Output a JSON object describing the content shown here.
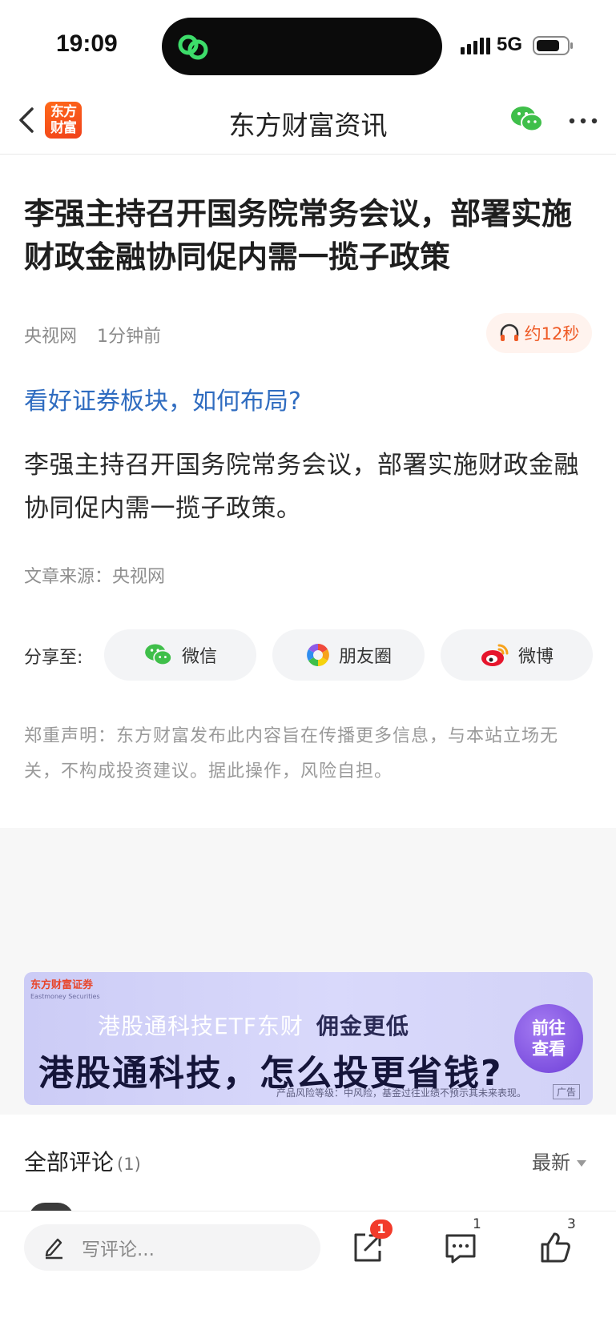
{
  "status_bar": {
    "time": "19:09",
    "network": "5G",
    "icons": [
      "link-icon",
      "signal-icon",
      "battery-icon"
    ]
  },
  "nav": {
    "logo_line1": "东方",
    "logo_line2": "财富",
    "title": "东方财富资讯",
    "icons": [
      "back-icon",
      "wechat-icon",
      "more-icon"
    ]
  },
  "article": {
    "headline": "李强主持召开国务院常务会议，部署实施财政金融协同促内需一揽子政策",
    "source": "央视网",
    "time_ago": "1分钟前",
    "audio_label": "约12秒",
    "promo_link": "看好证券板块，如何布局?",
    "body": "李强主持召开国务院常务会议，部署实施财政金融协同促内需一揽子政策。",
    "source_line": "文章来源：央视网"
  },
  "share": {
    "label": "分享至:",
    "buttons": [
      {
        "label": "微信",
        "icon": "wechat-icon"
      },
      {
        "label": "朋友圈",
        "icon": "moments-icon"
      },
      {
        "label": "微博",
        "icon": "weibo-icon"
      }
    ]
  },
  "disclaimer": "郑重声明：东方财富发布此内容旨在传播更多信息，与本站立场无关，不构成投资建议。据此操作，风险自担。",
  "ad": {
    "brand": "东方财富证券",
    "brand_en": "Eastmoney Securities",
    "line1": "港股通科技ETF东财",
    "line1_bold": "佣金更低",
    "line2": "港股通科技，怎么投更省钱?",
    "cta_line1": "前往",
    "cta_line2": "查看",
    "note": "产品风险等级：中风险，基金过往业绩不预示其未来表现。",
    "tag": "广告"
  },
  "comments": {
    "title": "全部评论",
    "count": "(1)",
    "sort_label": "最新"
  },
  "bottom_bar": {
    "placeholder": "写评论...",
    "share_badge": "1",
    "comment_count": "1",
    "like_count": "3"
  },
  "colors": {
    "accent_blue": "#2f6cc0",
    "brand_orange": "#f0401a",
    "audio_orange": "#ef5a25",
    "badge_red": "#f23b2b"
  }
}
